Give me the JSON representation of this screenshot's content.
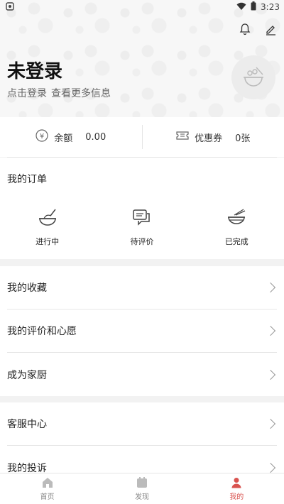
{
  "status_bar": {
    "time": "3:23"
  },
  "header": {
    "title": "未登录",
    "sub_login": "点击登录",
    "sub_more": "查看更多信息"
  },
  "wallet": {
    "balance_label": "余额",
    "balance_value": "0.00",
    "coupon_label": "优惠券",
    "coupon_value": "0张"
  },
  "orders": {
    "title": "我的订单",
    "items": [
      {
        "label": "进行中",
        "icon": "cooking-bowl-icon"
      },
      {
        "label": "待评价",
        "icon": "chat-bubbles-icon"
      },
      {
        "label": "已完成",
        "icon": "bowl-chopsticks-icon"
      }
    ]
  },
  "menu_group1": [
    {
      "label": "我的收藏"
    },
    {
      "label": "我的评价和心愿"
    },
    {
      "label": "成为家厨"
    }
  ],
  "menu_group2": [
    {
      "label": "客服中心"
    },
    {
      "label": "我的投诉"
    }
  ],
  "tabbar": {
    "tabs": [
      {
        "label": "首页",
        "icon": "home-icon"
      },
      {
        "label": "发现",
        "icon": "discover-icon"
      },
      {
        "label": "我的",
        "icon": "profile-icon",
        "active": true
      }
    ]
  },
  "colors": {
    "accent": "#d9534f",
    "background": "#f2f2f2"
  }
}
